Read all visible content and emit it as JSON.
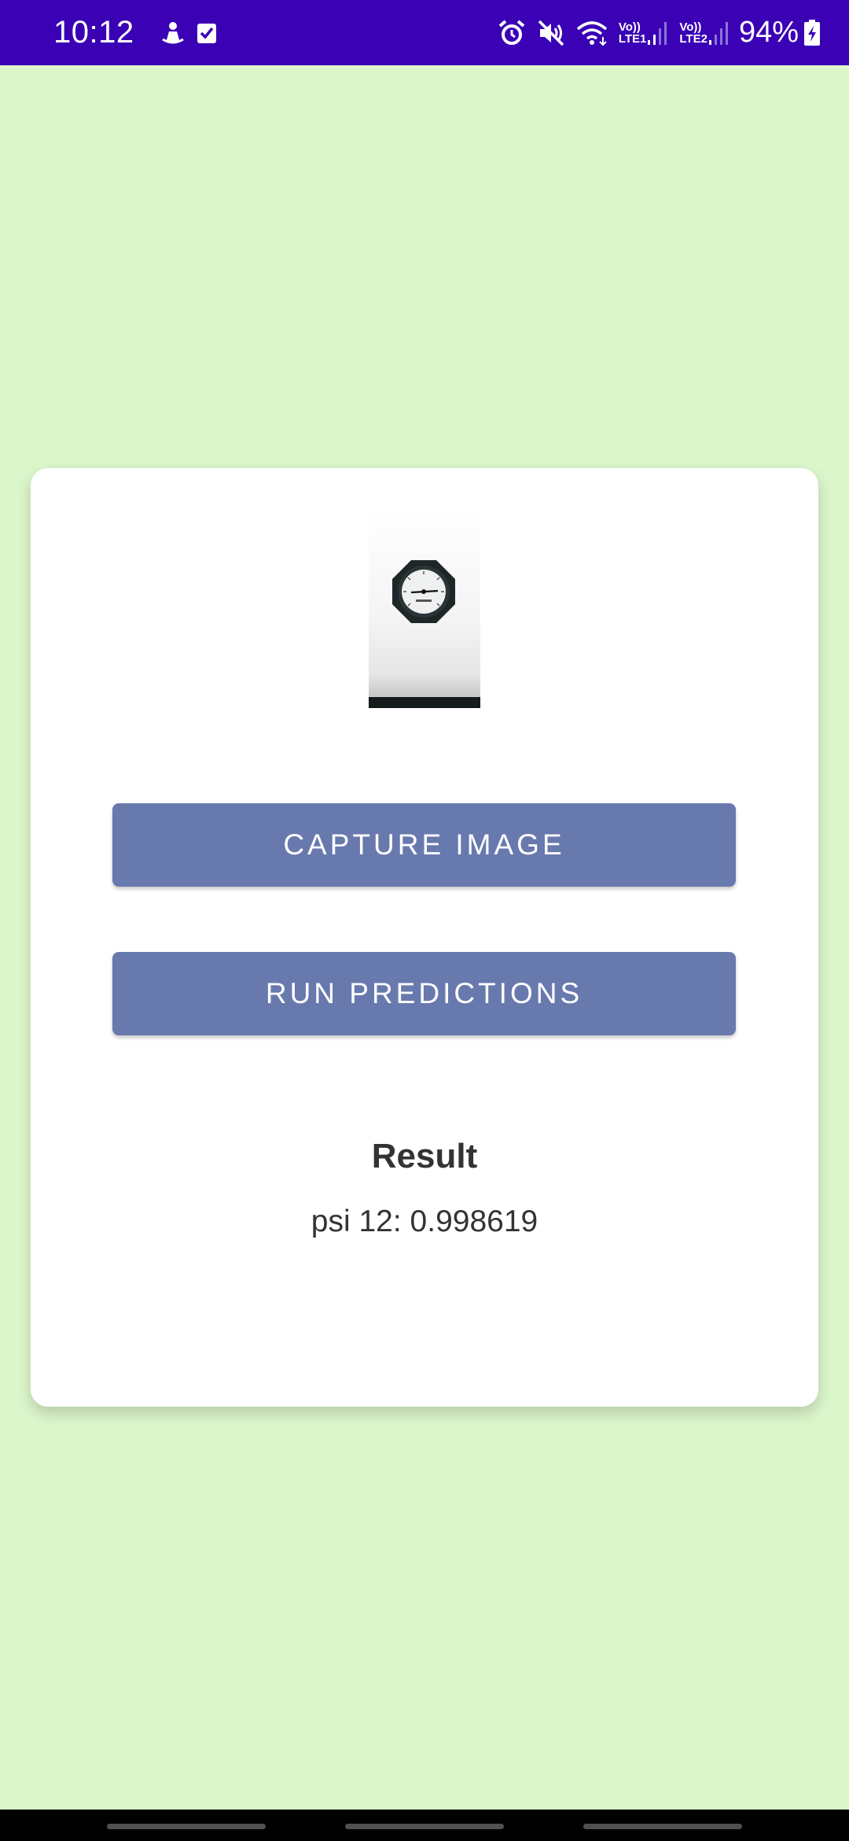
{
  "status_bar": {
    "time": "10:12",
    "lte1_label_top": "Vo))",
    "lte1_label_bottom": "LTE1",
    "lte2_label_top": "Vo))",
    "lte2_label_bottom": "LTE2",
    "battery_percent": "94%",
    "icons": [
      "upload-notification-icon",
      "task-checkbox-icon",
      "alarm-icon",
      "mute-icon",
      "wifi-icon",
      "signal-icon",
      "battery-charging-icon"
    ]
  },
  "card": {
    "preview_icon": "pressure-gauge-photo",
    "capture_button_label": "CAPTURE IMAGE",
    "run_button_label": "RUN PREDICTIONS",
    "result_title": "Result",
    "result_value": "psi 12: 0.998619"
  },
  "colors": {
    "status_bar": "#3a01b5",
    "background": "#dcf6cb",
    "button": "#6879ae",
    "card": "#ffffff"
  }
}
